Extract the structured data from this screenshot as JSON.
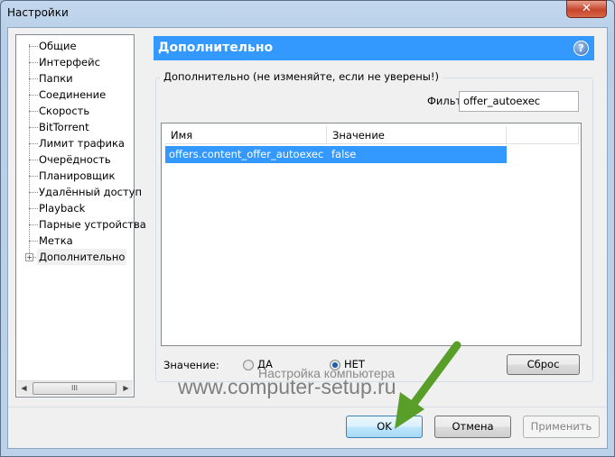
{
  "window": {
    "title": "Настройки",
    "close_icon": "close-icon"
  },
  "sidebar": {
    "items": [
      {
        "label": "Общие"
      },
      {
        "label": "Интерфейс"
      },
      {
        "label": "Папки"
      },
      {
        "label": "Соединение"
      },
      {
        "label": "Скорость"
      },
      {
        "label": "BitTorrent"
      },
      {
        "label": "Лимит трафика"
      },
      {
        "label": "Очерёдность"
      },
      {
        "label": "Планировщик"
      },
      {
        "label": "Удалённый доступ"
      },
      {
        "label": "Playback"
      },
      {
        "label": "Парные устройства"
      },
      {
        "label": "Метка"
      },
      {
        "label": "Дополнительно",
        "expandable": true,
        "selected": true
      }
    ],
    "scroll_thumb": "III"
  },
  "panel": {
    "title": "Дополнительно",
    "help": "?",
    "group_label": "Дополнительно (не изменяйте, если не уверены!)",
    "filter_label": "Фильт",
    "filter_value": "offer_autoexec"
  },
  "table": {
    "columns": [
      "Имя",
      "Значение"
    ],
    "rows": [
      {
        "name": "offers.content_offer_autoexec",
        "value": "false",
        "selected": true
      }
    ]
  },
  "value_editor": {
    "label": "Значение:",
    "options": [
      {
        "label": "ДА",
        "checked": false
      },
      {
        "label": "НЕТ",
        "checked": true
      }
    ],
    "reset": "Сброс"
  },
  "footer": {
    "ok": "OK",
    "cancel": "Отмена",
    "apply": "Применить",
    "apply_disabled": true
  },
  "watermark": {
    "line1": "Настройка компьютера",
    "line2": "www.computer-setup.ru"
  },
  "colors": {
    "accent": "#3399ff",
    "arrow": "#5a9e2a"
  }
}
